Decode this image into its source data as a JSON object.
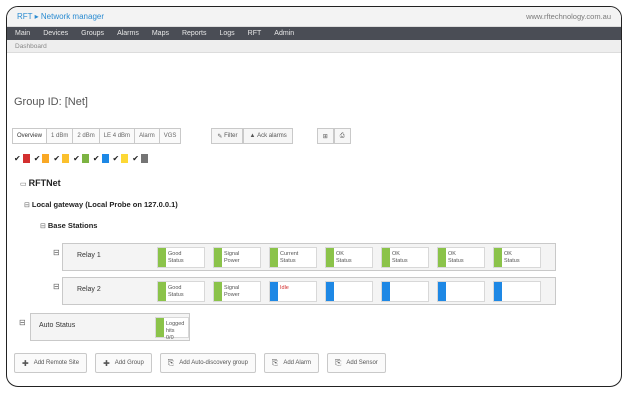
{
  "header": {
    "brand": "RFT ▸ Network manager",
    "site_url": "www.rftechnology.com.au"
  },
  "menu": [
    "Main",
    "Devices",
    "Groups",
    "Alarms",
    "Maps",
    "Reports",
    "Logs",
    "RFT",
    "Admin"
  ],
  "breadcrumb": "Dashboard",
  "page_title": "Group ID: [Net]",
  "tabs": [
    "Overview",
    "1 dBm",
    "2 dBm",
    "LE 4 dBm",
    "Alarm",
    "VGS"
  ],
  "tools": {
    "filter": "Filter",
    "alarm_ack": "Ack alarms",
    "grid": "⊞",
    "print": "⎙"
  },
  "swatches": [
    {
      "color": "#d32f2f",
      "t": ""
    },
    {
      "color": "#f9a825",
      "t": ""
    },
    {
      "color": "#fbc02d",
      "t": ""
    },
    {
      "color": "#7cb342",
      "t": ""
    },
    {
      "color": "#1e88e5",
      "t": ""
    },
    {
      "color": "#fdd835",
      "t": ""
    },
    {
      "color": "#757575",
      "t": ""
    }
  ],
  "tree": {
    "root": "RFTNet",
    "local": "Local gateway (Local Probe on 127.0.0.1)",
    "base": "Base Stations"
  },
  "rows": [
    {
      "name": "Relay 1",
      "cells": [
        {
          "bar": "#8bc34a",
          "l1": "Good",
          "l2": "Status"
        },
        {
          "bar": "#8bc34a",
          "l1": "Signal",
          "l2": "Power"
        },
        {
          "bar": "#8bc34a",
          "l1": "Current",
          "l2": "Status"
        },
        {
          "bar": "#8bc34a",
          "l1": "OK",
          "l2": "Status"
        },
        {
          "bar": "#8bc34a",
          "l1": "OK",
          "l2": "Status"
        },
        {
          "bar": "#8bc34a",
          "l1": "OK",
          "l2": "Status"
        },
        {
          "bar": "#8bc34a",
          "l1": "OK",
          "l2": "Status"
        }
      ]
    },
    {
      "name": "Relay 2",
      "cells": [
        {
          "bar": "#8bc34a",
          "l1": "Good",
          "l2": "Status"
        },
        {
          "bar": "#8bc34a",
          "l1": "Signal",
          "l2": "Power"
        },
        {
          "bar": "#1e88e5",
          "l1": "Idle",
          "l2": ""
        },
        {
          "bar": "#1e88e5",
          "l1": "",
          "l2": ""
        },
        {
          "bar": "#1e88e5",
          "l1": "",
          "l2": ""
        },
        {
          "bar": "#1e88e5",
          "l1": "",
          "l2": ""
        },
        {
          "bar": "#1e88e5",
          "l1": "",
          "l2": ""
        }
      ]
    }
  ],
  "action_row": {
    "name": "Auto Status",
    "l1": "Logged hits",
    "l2": "0/0"
  },
  "buttons": [
    {
      "icon": "✚",
      "label": "Add Remote Site"
    },
    {
      "icon": "✚",
      "label": "Add Group"
    },
    {
      "icon": "⎘",
      "label": "Add Auto-discovery group"
    },
    {
      "icon": "⎘",
      "label": "Add Alarm"
    },
    {
      "icon": "⎘",
      "label": "Add Sensor"
    }
  ]
}
